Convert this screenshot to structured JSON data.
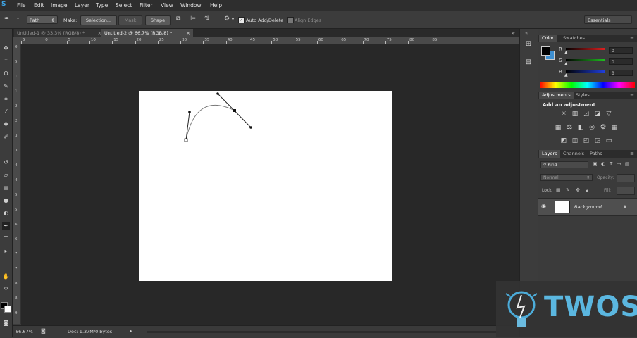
{
  "app": {
    "logo": "S"
  },
  "menu": [
    "File",
    "Edit",
    "Image",
    "Layer",
    "Type",
    "Select",
    "Filter",
    "View",
    "Window",
    "Help"
  ],
  "options_bar": {
    "tool_mode": "Path",
    "make_label": "Make:",
    "selection_button": "Selection...",
    "mask_button": "Mask",
    "shape_button": "Shape",
    "auto_add_delete": "Auto Add/Delete",
    "align_edges": "Align Edges",
    "workspace": "Essentials"
  },
  "tabs": [
    {
      "label": "Untitled-1 @ 33.3% (RGB/8) *"
    },
    {
      "label": "Untitled-2 @ 66.7% (RGB/8) *"
    }
  ],
  "ruler_h": [
    "5",
    "0",
    "5",
    "10",
    "15",
    "20",
    "25",
    "30",
    "35",
    "40",
    "45",
    "50",
    "55",
    "60",
    "65",
    "70",
    "75",
    "80",
    "85"
  ],
  "ruler_v": [
    "0",
    "5",
    "1",
    "1",
    "2",
    "2",
    "3",
    "3",
    "4",
    "4",
    "5",
    "5",
    "6",
    "6",
    "7",
    "7",
    "8",
    "8",
    "9"
  ],
  "status": {
    "zoom": "66.67%",
    "doc": "Doc: 1.37M/0 bytes"
  },
  "color_panel": {
    "tabs": [
      "Color",
      "Swatches"
    ],
    "channels": [
      {
        "name": "R",
        "value": "0",
        "color": "#e02020"
      },
      {
        "name": "G",
        "value": "0",
        "color": "#20c020"
      },
      {
        "name": "B",
        "value": "0",
        "color": "#2040e0"
      }
    ]
  },
  "adjustments_panel": {
    "tabs": [
      "Adjustments",
      "Styles"
    ],
    "title": "Add an adjustment"
  },
  "layers_panel": {
    "tabs": [
      "Layers",
      "Channels",
      "Paths"
    ],
    "filter": "Kind",
    "blend_mode": "Normal",
    "opacity_label": "Opacity:",
    "fill_label": "Fill:",
    "lock_label": "Lock:",
    "layers": [
      {
        "name": "Background"
      }
    ]
  },
  "watermark": {
    "text": "TWOS"
  }
}
